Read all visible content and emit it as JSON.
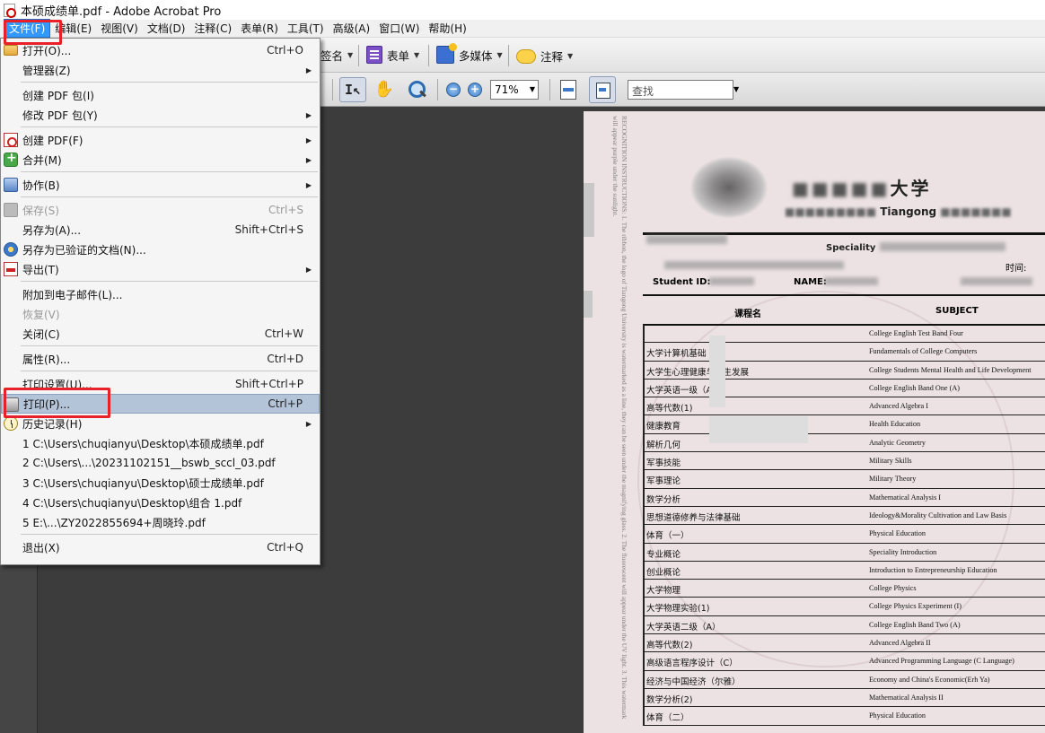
{
  "window": {
    "title": "本硕成绩单.pdf - Adobe Acrobat Pro"
  },
  "menubar": {
    "items": [
      "文件(F)",
      "编辑(E)",
      "视图(V)",
      "文档(D)",
      "注释(C)",
      "表单(R)",
      "工具(T)",
      "高级(A)",
      "窗口(W)",
      "帮助(H)"
    ]
  },
  "toolbar": {
    "sign_label": "签名",
    "forms_label": "表单",
    "multimedia_label": "多媒体",
    "comment_label": "注释",
    "zoom_value": "71%",
    "search_placeholder": "查找"
  },
  "file_menu": {
    "open": {
      "label": "打开(O)...",
      "shortcut": "Ctrl+O"
    },
    "organizer": {
      "label": "管理器(Z)"
    },
    "create_package": {
      "label": "创建 PDF 包(I)"
    },
    "modify_package": {
      "label": "修改 PDF 包(Y)"
    },
    "create_pdf": {
      "label": "创建 PDF(F)"
    },
    "combine": {
      "label": "合并(M)"
    },
    "collaborate": {
      "label": "协作(B)"
    },
    "save": {
      "label": "保存(S)",
      "shortcut": "Ctrl+S"
    },
    "save_as": {
      "label": "另存为(A)...",
      "shortcut": "Shift+Ctrl+S"
    },
    "save_certified": {
      "label": "另存为已验证的文档(N)..."
    },
    "export": {
      "label": "导出(T)"
    },
    "attach_email": {
      "label": "附加到电子邮件(L)..."
    },
    "revert": {
      "label": "恢复(V)"
    },
    "close": {
      "label": "关闭(C)",
      "shortcut": "Ctrl+W"
    },
    "properties": {
      "label": "属性(R)...",
      "shortcut": "Ctrl+D"
    },
    "print_setup": {
      "label": "打印设置(U)...",
      "shortcut": "Shift+Ctrl+P"
    },
    "print": {
      "label": "打印(P)...",
      "shortcut": "Ctrl+P"
    },
    "history": {
      "label": "历史记录(H)"
    },
    "recent": [
      "1 C:\\Users\\chuqianyu\\Desktop\\本硕成绩单.pdf",
      "2 C:\\Users\\...\\20231102151__bswb_sccl_03.pdf",
      "3 C:\\Users\\chuqianyu\\Desktop\\硕士成绩单.pdf",
      "4 C:\\Users\\chuqianyu\\Desktop\\组合 1.pdf",
      "5 E:\\...\\ZY2022855694+周晓玲.pdf"
    ],
    "exit": {
      "label": "退出(X)",
      "shortcut": "Ctrl+Q"
    }
  },
  "document": {
    "university_cn": "大学",
    "university_en_suffix": "Tiangong",
    "specialty_label": "Speciality",
    "student_id_label": "Student ID:",
    "name_label": "NAME:",
    "time_label": "时间:",
    "col_course_cn": "课程名",
    "col_subject": "SUBJECT",
    "vertical_note": "RECOGNITION INSTRUCTIONS: 1. The ribbon, the logo of Tiangong University is watermarked as a line, they can be seen under the magnifying glass. 2. The fluorescent will appear under the UV light. 3. This watermark will appear purple under the sunlight.",
    "courses": [
      {
        "cn": "",
        "en": "College English Test Band Four"
      },
      {
        "cn": "大学计算机基础",
        "en": "Fundamentals of College Computers"
      },
      {
        "cn": "大学生心理健康与人生发展",
        "en": "College Students Mental Health and Life Development"
      },
      {
        "cn": "大学英语一级（A）",
        "en": "College English Band One (A)"
      },
      {
        "cn": "高等代数(1)",
        "en": "Advanced Algebra I"
      },
      {
        "cn": "健康教育",
        "en": "Health Education"
      },
      {
        "cn": "解析几何",
        "en": "Analytic Geometry"
      },
      {
        "cn": "军事技能",
        "en": "Military Skills"
      },
      {
        "cn": "军事理论",
        "en": "Military Theory"
      },
      {
        "cn": "数学分析",
        "en": "Mathematical Analysis I"
      },
      {
        "cn": "思想道德修养与法律基础",
        "en": "Ideology&Morality Cultivation and Law Basis"
      },
      {
        "cn": "体育（一）",
        "en": "Physical Education"
      },
      {
        "cn": "专业概论",
        "en": "Speciality Introduction"
      },
      {
        "cn": "创业概论",
        "en": "Introduction to Entrepreneurship Education"
      },
      {
        "cn": "大学物理",
        "en": "College Physics"
      },
      {
        "cn": "大学物理实验(1)",
        "en": "College Physics Experiment (I)"
      },
      {
        "cn": "大学英语二级（A）",
        "en": "College English Band Two (A)"
      },
      {
        "cn": "高等代数(2)",
        "en": "Advanced Algebra II"
      },
      {
        "cn": "高级语言程序设计（C）",
        "en": "Advanced Programming Language (C Language)"
      },
      {
        "cn": "经济与中国经济（尔雅）",
        "en": "Economy and China's Economic(Erh Ya)"
      },
      {
        "cn": "数学分析(2)",
        "en": "Mathematical Analysis II"
      },
      {
        "cn": "体育（二）",
        "en": "Physical Education"
      }
    ]
  }
}
